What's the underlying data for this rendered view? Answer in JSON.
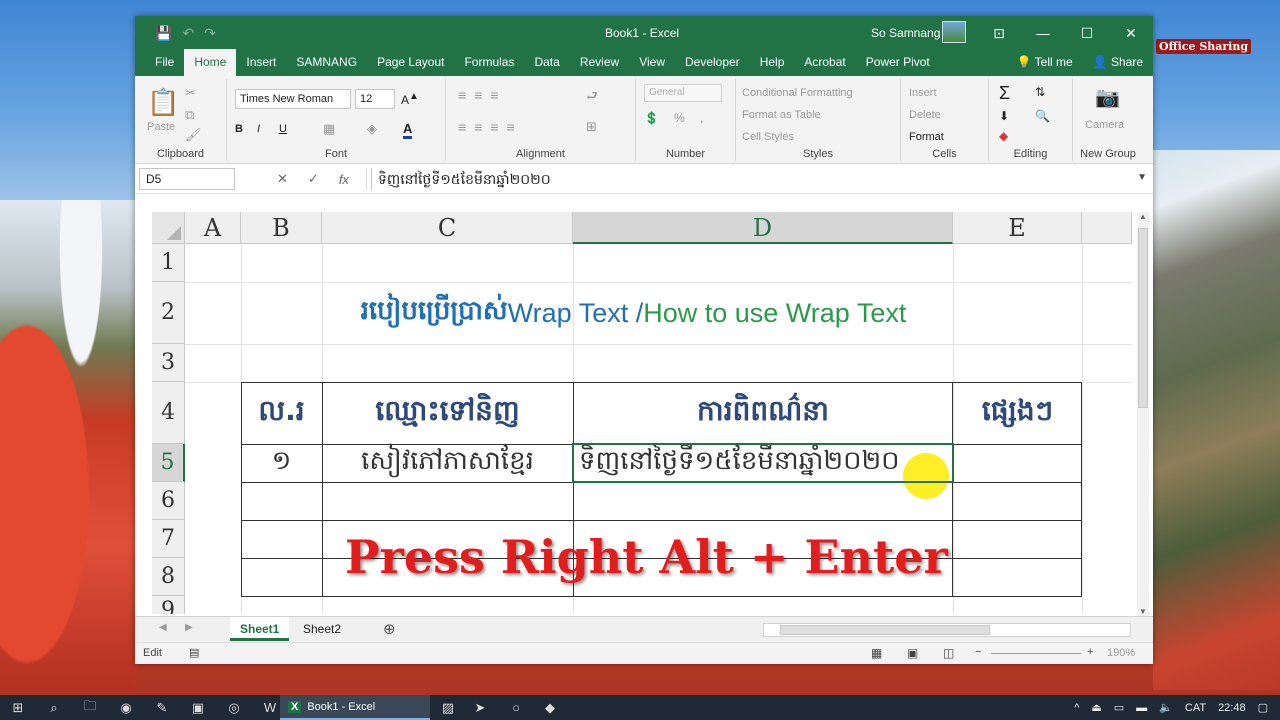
{
  "watermark": "Office Sharing",
  "window": {
    "title": "Book1  -  Excel",
    "user": "So Samnang",
    "controls": {
      "ribbon_display": "⊡",
      "minimize": "—",
      "maximize": "☐",
      "close": "✕"
    }
  },
  "quick_access": {
    "save": "💾",
    "undo": "↶",
    "redo": "↷"
  },
  "menu": {
    "tabs": [
      "File",
      "Home",
      "Insert",
      "SAMNANG",
      "Page Layout",
      "Formulas",
      "Data",
      "Review",
      "View",
      "Developer",
      "Help",
      "Acrobat",
      "Power Pivot"
    ],
    "active": "Home",
    "tell_me": "Tell me",
    "share": "Share"
  },
  "ribbon": {
    "clipboard": {
      "label": "Clipboard",
      "paste": "Paste"
    },
    "font": {
      "label": "Font",
      "name": "Times New Roman",
      "size": "12",
      "bold": "B",
      "italic": "I",
      "underline": "U"
    },
    "alignment": {
      "label": "Alignment"
    },
    "number": {
      "label": "Number",
      "format": "General",
      "percent": "%"
    },
    "styles": {
      "label": "Styles",
      "conditional": "Conditional Formatting",
      "table": "Format as Table",
      "cell_styles": "Cell Styles"
    },
    "cells": {
      "label": "Cells",
      "insert": "Insert",
      "delete": "Delete",
      "format": "Format"
    },
    "editing": {
      "label": "Editing",
      "sum": "Σ"
    },
    "new_group": {
      "label": "New Group",
      "camera": "Camera"
    }
  },
  "formula_bar": {
    "name_box": "D5",
    "cancel": "✕",
    "enter": "✓",
    "fx": "fx",
    "content": "ទិញនៅថ្ងៃទី១៥ខែមីនាឆ្នាំ២០២០"
  },
  "sheet": {
    "columns": [
      "A",
      "B",
      "C",
      "D",
      "E"
    ],
    "rows": [
      "1",
      "2",
      "3",
      "4",
      "5",
      "6",
      "7",
      "8",
      "9"
    ],
    "title_khmer": "របៀបប្រើប្រាស់",
    "title_en1": " Wrap Text /",
    "title_en2": "How to use Wrap Text",
    "headers": [
      "ល.រ",
      "ឈ្មោះទៅនិញ",
      "ការពិពណ៌នា",
      "ផ្សេងៗ"
    ],
    "row5": [
      "១",
      "សៀវភៅភាសាខ្មែរ",
      "ទិញនៅថ្ងៃទី១៥ខែមីនាឆ្នាំ២០២០",
      ""
    ],
    "overlay": "Press Right Alt + Enter",
    "colors": {
      "title_blue": "#1f6fb5",
      "title_green": "#2a9a4a",
      "header_text": "#2d4a7a",
      "overlay_red": "#e11d1d",
      "excel_green": "#217346"
    }
  },
  "tabs": {
    "sheets": [
      "Sheet1",
      "Sheet2"
    ],
    "active": "Sheet1",
    "add": "⊕"
  },
  "status": {
    "mode": "Edit",
    "zoom": "190%"
  },
  "taskbar": {
    "app": "Book1 - Excel",
    "lang": "CAT",
    "time": "22:48"
  }
}
